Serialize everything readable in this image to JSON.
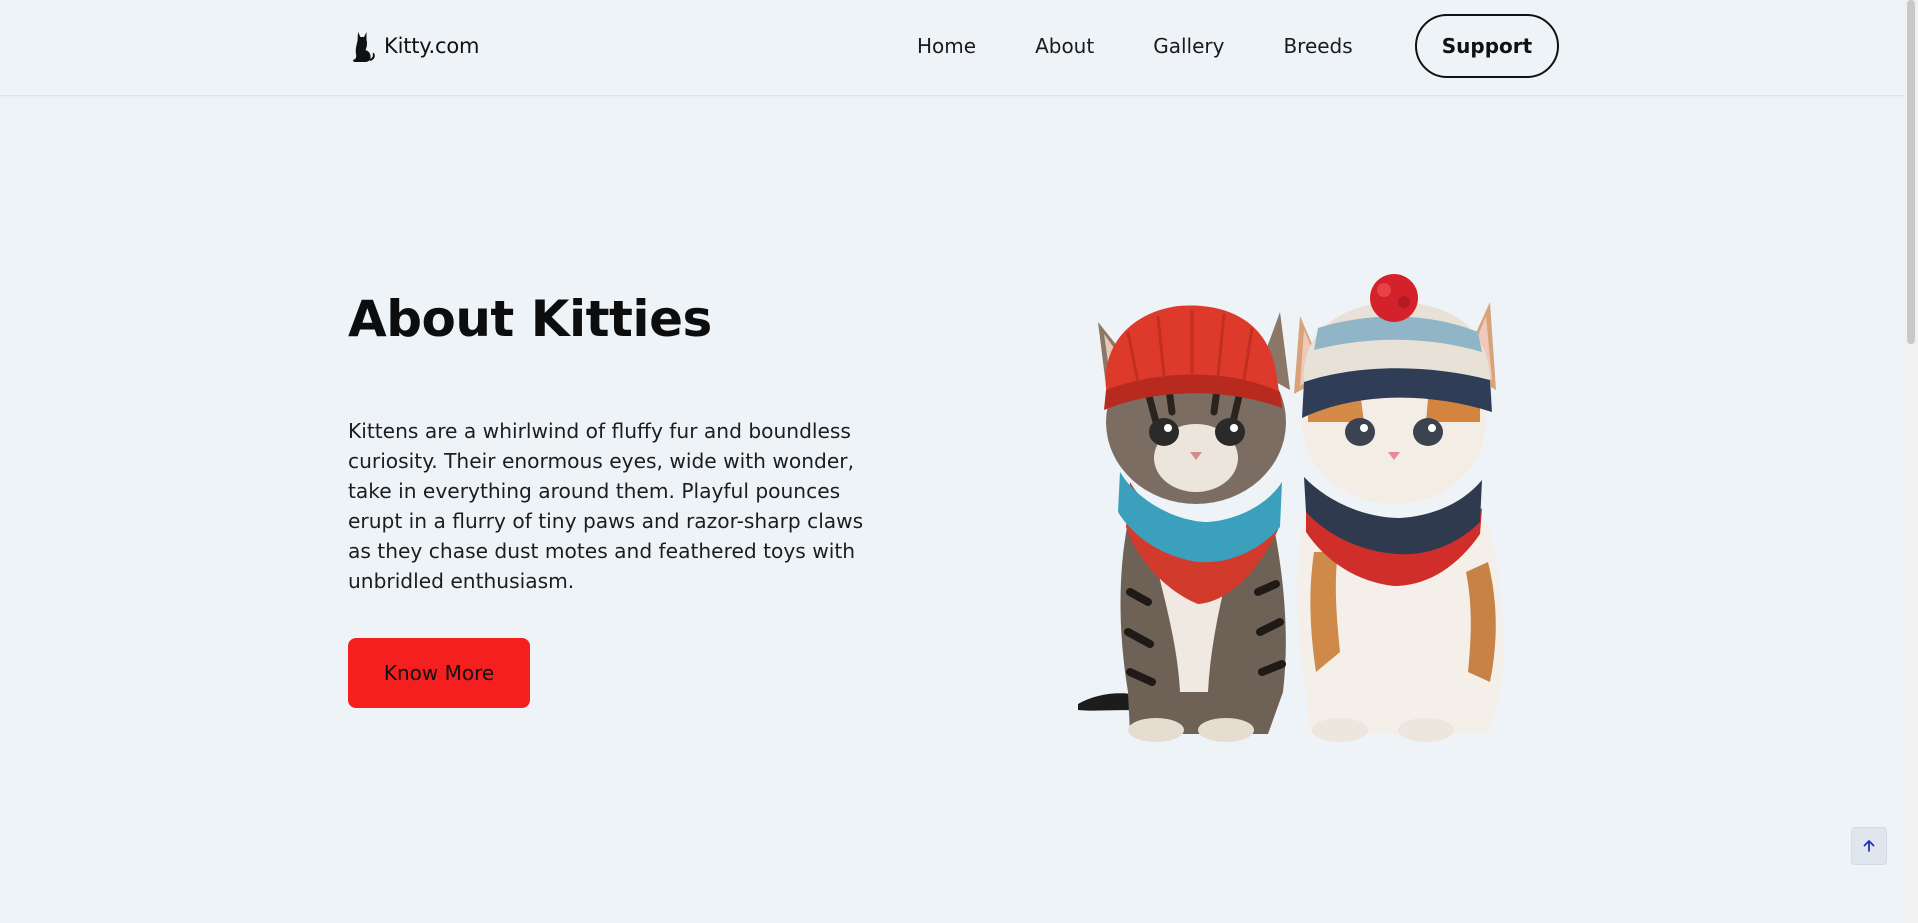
{
  "header": {
    "brand_name": "Kitty.com",
    "logo_icon": "cat-silhouette-icon",
    "nav": [
      {
        "label": "Home"
      },
      {
        "label": "About"
      },
      {
        "label": "Gallery"
      },
      {
        "label": "Breeds"
      }
    ],
    "support_label": "Support"
  },
  "hero": {
    "title": "About Kitties",
    "body": "Kittens are a whirlwind of fluffy fur and boundless curiosity. Their enormous eyes, wide with wonder, take in everything around them. Playful pounces erupt in a flurry of tiny paws and razor-sharp claws as they chase dust motes and feathered toys with unbridled enthusiasm.",
    "cta_label": "Know More",
    "image_alt": "Two kittens wearing knitted hats and scarves"
  },
  "back_to_top_icon": "arrow-up-icon",
  "colors": {
    "background": "#eef3f7",
    "cta": "#f51f1f",
    "back_to_top_arrow": "#2330c4"
  }
}
